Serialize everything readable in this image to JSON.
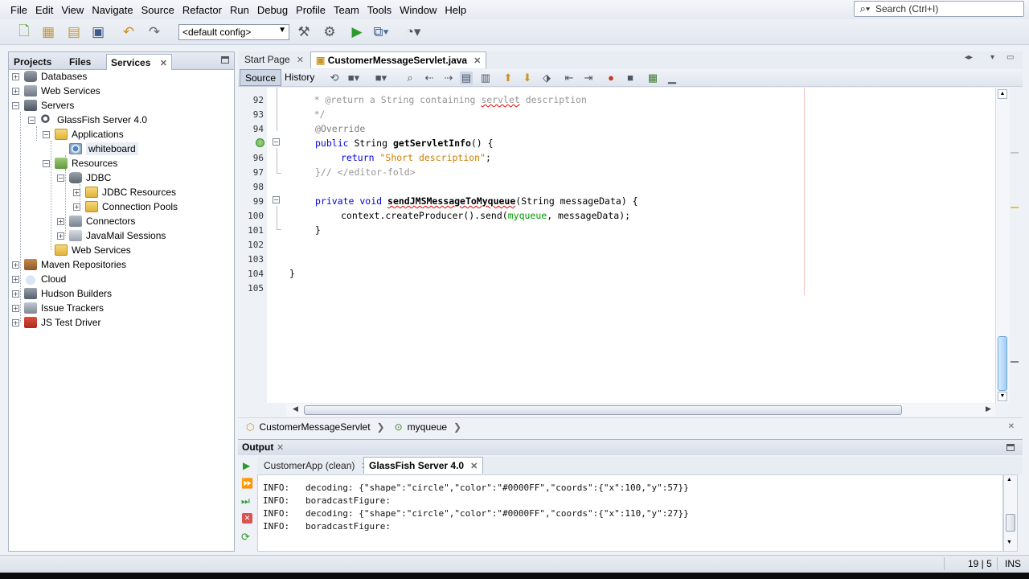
{
  "menu": [
    "File",
    "Edit",
    "View",
    "Navigate",
    "Source",
    "Refactor",
    "Run",
    "Debug",
    "Profile",
    "Team",
    "Tools",
    "Window",
    "Help"
  ],
  "search": {
    "placeholder": "Search (Ctrl+I)"
  },
  "toolbar": {
    "config": "<default config>"
  },
  "left_tabs": {
    "projects": "Projects",
    "files": "Files",
    "services": "Services",
    "close": "✕"
  },
  "tree": [
    {
      "label": "Databases",
      "icon": "database-icon"
    },
    {
      "label": "Web Services",
      "icon": "web-services-icon"
    },
    {
      "label": "Servers",
      "icon": "servers-icon"
    },
    {
      "label": "GlassFish Server 4.0",
      "icon": "glassfish-icon"
    },
    {
      "label": "Applications",
      "icon": "folder-icon"
    },
    {
      "label": "whiteboard",
      "icon": "application-icon"
    },
    {
      "label": "Resources",
      "icon": "resources-icon"
    },
    {
      "label": "JDBC",
      "icon": "database-icon"
    },
    {
      "label": "JDBC Resources",
      "icon": "folder-icon"
    },
    {
      "label": "Connection Pools",
      "icon": "folder-icon"
    },
    {
      "label": "Connectors",
      "icon": "connectors-icon"
    },
    {
      "label": "JavaMail Sessions",
      "icon": "mail-icon"
    },
    {
      "label": "Web Services",
      "icon": "folder-icon"
    },
    {
      "label": "Maven Repositories",
      "icon": "maven-icon"
    },
    {
      "label": "Cloud",
      "icon": "cloud-icon"
    },
    {
      "label": "Hudson Builders",
      "icon": "hudson-icon"
    },
    {
      "label": "Issue Trackers",
      "icon": "issue-tracker-icon"
    },
    {
      "label": "JS Test Driver",
      "icon": "js-test-driver-icon"
    }
  ],
  "editor_tabs": {
    "start": "Start Page",
    "file": "CustomerMessageServlet.java"
  },
  "editor_toolbar": {
    "source": "Source",
    "history": "History"
  },
  "code": {
    "line_numbers": [
      "92",
      "93",
      "94",
      "",
      "96",
      "97",
      "98",
      "99",
      "100",
      "101",
      "102",
      "103",
      "104",
      "105"
    ],
    "l92": "     * @return a String containing ",
    "l92b": "servlet",
    "l92c": " description",
    "l93": "     */",
    "l94": "@Override",
    "l95a": "public",
    "l95b": " String ",
    "l95c": "getServletInfo",
    "l95d": "() {",
    "l96a": "return",
    "l96b": "\"Short description\"",
    "l96c": ";",
    "l97": "}// </editor-fold>",
    "l99a": "private void",
    "l99b": "sendJMSMessageToMyqueue",
    "l99c": "(String messageData) {",
    "l100a": "context.createProducer().send(",
    "l100b": "myqueue",
    "l100c": ", messageData);",
    "l101": "}",
    "l104": "}"
  },
  "breadcrumb": {
    "class": "CustomerMessageServlet",
    "field": "myqueue"
  },
  "output": {
    "title": "Output",
    "tab1": "CustomerApp (clean)",
    "tab2": "GlassFish Server 4.0",
    "lines": [
      "INFO:   decoding: {\"shape\":\"circle\",\"color\":\"#0000FF\",\"coords\":{\"x\":100,\"y\":57}}",
      "INFO:   boradcastFigure:",
      "INFO:   decoding: {\"shape\":\"circle\",\"color\":\"#0000FF\",\"coords\":{\"x\":110,\"y\":27}}",
      "INFO:   boradcastFigure:"
    ]
  },
  "status": {
    "position": "19 | 5",
    "mode": "INS"
  },
  "colors": {
    "keyword": "#0000e6",
    "string": "#ce7b00",
    "field": "#009900",
    "comment": "#969696"
  }
}
